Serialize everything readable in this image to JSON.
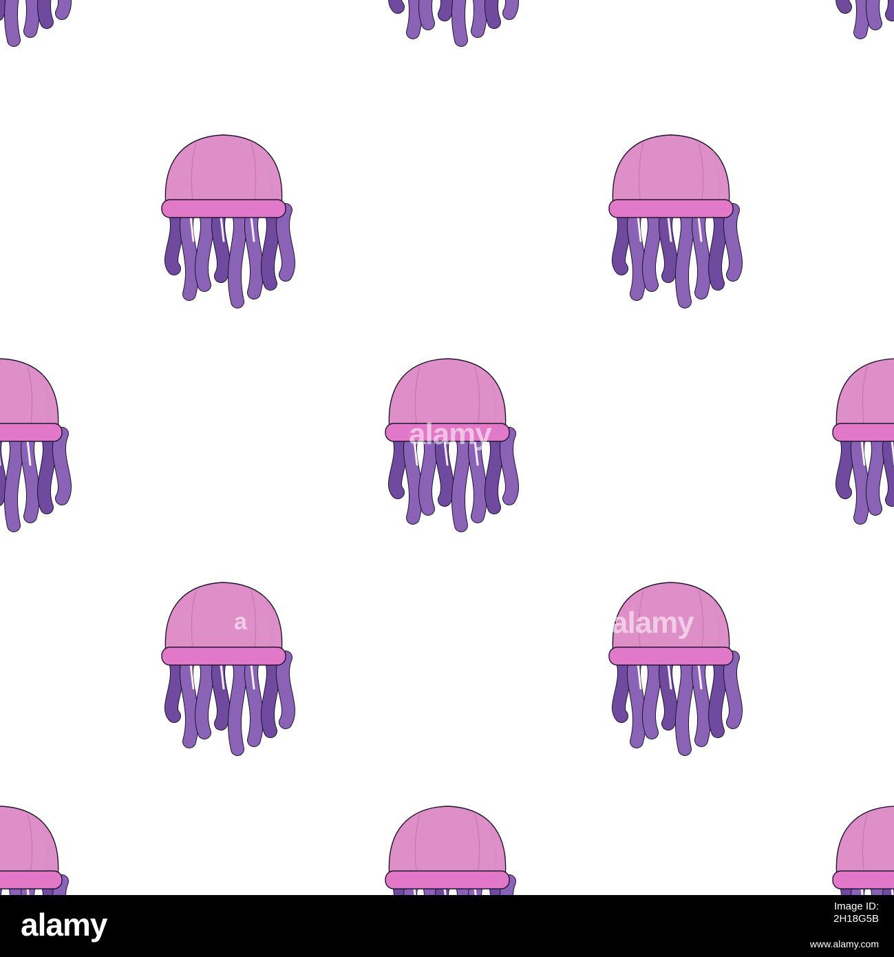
{
  "pattern": {
    "subject": "jellyfish",
    "background_color": "#ffffff",
    "bell_color": "#df8fc7",
    "bell_rim_color": "#e178c8",
    "bell_outline_color": "#1e1430",
    "tentacle_color": "#8a62b6",
    "tentacle_dark_color": "#6f4a9e"
  },
  "watermarks": [
    "alamy",
    "a",
    "alamy"
  ],
  "footer": {
    "logo": "alamy",
    "image_id_label": "Image ID:",
    "image_id": "2H18G5B",
    "url": "www.alamy.com"
  }
}
